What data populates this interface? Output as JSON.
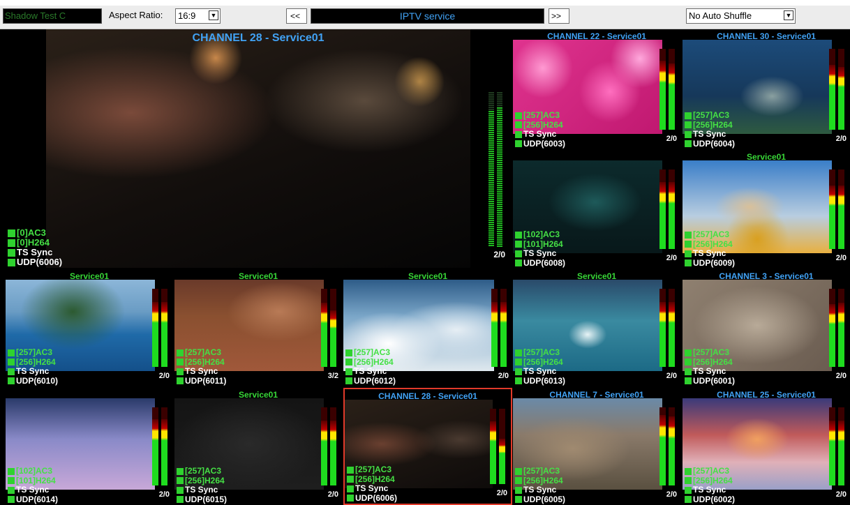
{
  "toolbar": {
    "shadow_field_value": "Shadow Test C",
    "aspect_label": "Aspect Ratio:",
    "aspect_value": "16:9",
    "prev_label": "<<",
    "service_title": "IPTV service",
    "next_label": ">>",
    "shuffle_value": "No Auto Shuffle",
    "dropdown_glyph": "▼"
  },
  "tiles": [
    {
      "title": "CHANNEL 28 - Service01",
      "audio": "[0]AC3",
      "video": "[0]H264",
      "sync": "TS Sync",
      "udp": "UDP(6006)",
      "ratio": "2/0",
      "levels": [
        0.88,
        0.9
      ],
      "scene": "night-car"
    },
    {
      "title": "CHANNEL 22 - Service01",
      "audio": "[257]AC3",
      "video": "[256]H264",
      "sync": "TS Sync",
      "udp": "UDP(6003)",
      "ratio": "2/0",
      "levels": [
        0.85,
        0.82
      ],
      "scene": "pink-flowers"
    },
    {
      "title": "CHANNEL 30 - Service01",
      "audio": "[257]AC3",
      "video": "[256]H264",
      "sync": "TS Sync",
      "udp": "UDP(6004)",
      "ratio": "2/0",
      "levels": [
        0.8,
        0.78
      ],
      "scene": "underwater"
    },
    {
      "title": "",
      "audio": "[102]AC3",
      "video": "[101]H264",
      "sync": "TS Sync",
      "udp": "UDP(6008)",
      "ratio": "2/0",
      "levels": [
        0.84,
        0.84
      ],
      "scene": "diver"
    },
    {
      "title": "Service01",
      "audio": "[257]AC3",
      "video": "[256]H264",
      "sync": "TS Sync",
      "udp": "UDP(6009)",
      "ratio": "2/0",
      "levels": [
        0.8,
        0.8
      ],
      "scene": "skier"
    },
    {
      "title": "Service01",
      "audio": "[257]AC3",
      "video": "[256]H264",
      "sync": "TS Sync",
      "udp": "UDP(6010)",
      "ratio": "2/0",
      "levels": [
        0.83,
        0.83
      ],
      "scene": "ship"
    },
    {
      "title": "Service01",
      "audio": "[257]AC3",
      "video": "[256]H264",
      "sync": "TS Sync",
      "udp": "UDP(6011)",
      "ratio": "3/2",
      "levels": [
        0.82,
        0.72
      ],
      "scene": "desert"
    },
    {
      "title": "Service01",
      "audio": "[257]AC3",
      "video": "[256]H264",
      "sync": "TS Sync",
      "udp": "UDP(6012)",
      "ratio": "2/0",
      "levels": [
        0.83,
        0.83
      ],
      "scene": "clouds"
    },
    {
      "title": "Service01",
      "audio": "[257]AC3",
      "video": "[256]H264",
      "sync": "TS Sync",
      "udp": "UDP(6013)",
      "ratio": "2/0",
      "levels": [
        0.83,
        0.83
      ],
      "scene": "wave"
    },
    {
      "title": "CHANNEL 3 - Service01",
      "audio": "[257]AC3",
      "video": "[256]H264",
      "sync": "TS Sync",
      "udp": "UDP(6001)",
      "ratio": "2/0",
      "levels": [
        0.8,
        0.82
      ],
      "scene": "free-people"
    },
    {
      "title": "",
      "audio": "[102]AC3",
      "video": "[101]H264",
      "sync": "TS Sync",
      "udp": "UDP(6014)",
      "ratio": "2/0",
      "levels": [
        0.85,
        0.85
      ],
      "scene": "jets"
    },
    {
      "title": "Service01",
      "audio": "[257]AC3",
      "video": "[256]H264",
      "sync": "TS Sync",
      "udp": "UDP(6015)",
      "ratio": "2/0",
      "levels": [
        0.83,
        0.83
      ],
      "scene": "quote"
    },
    {
      "title": "CHANNEL 28 - Service01",
      "audio": "[257]AC3",
      "video": "[256]H264",
      "sync": "TS Sync",
      "udp": "UDP(6006)",
      "ratio": "2/0",
      "levels": [
        0.83,
        0.6
      ],
      "scene": "night-car-small",
      "selected": true
    },
    {
      "title": "CHANNEL 7 - Service01",
      "audio": "[257]AC3",
      "video": "[256]H264",
      "sync": "TS Sync",
      "udp": "UDP(6005)",
      "ratio": "2/0",
      "levels": [
        0.9,
        0.88
      ],
      "scene": "town"
    },
    {
      "title": "CHANNEL 25 - Service01",
      "audio": "[257]AC3",
      "video": "[256]H264",
      "sync": "TS Sync",
      "udp": "UDP(6002)",
      "ratio": "2/0",
      "levels": [
        0.83,
        0.83
      ],
      "scene": "sunset"
    }
  ],
  "colors": {
    "accent_blue": "#41a2f4",
    "ok_green": "#2fd22f",
    "selection_red": "#e23a2a"
  }
}
